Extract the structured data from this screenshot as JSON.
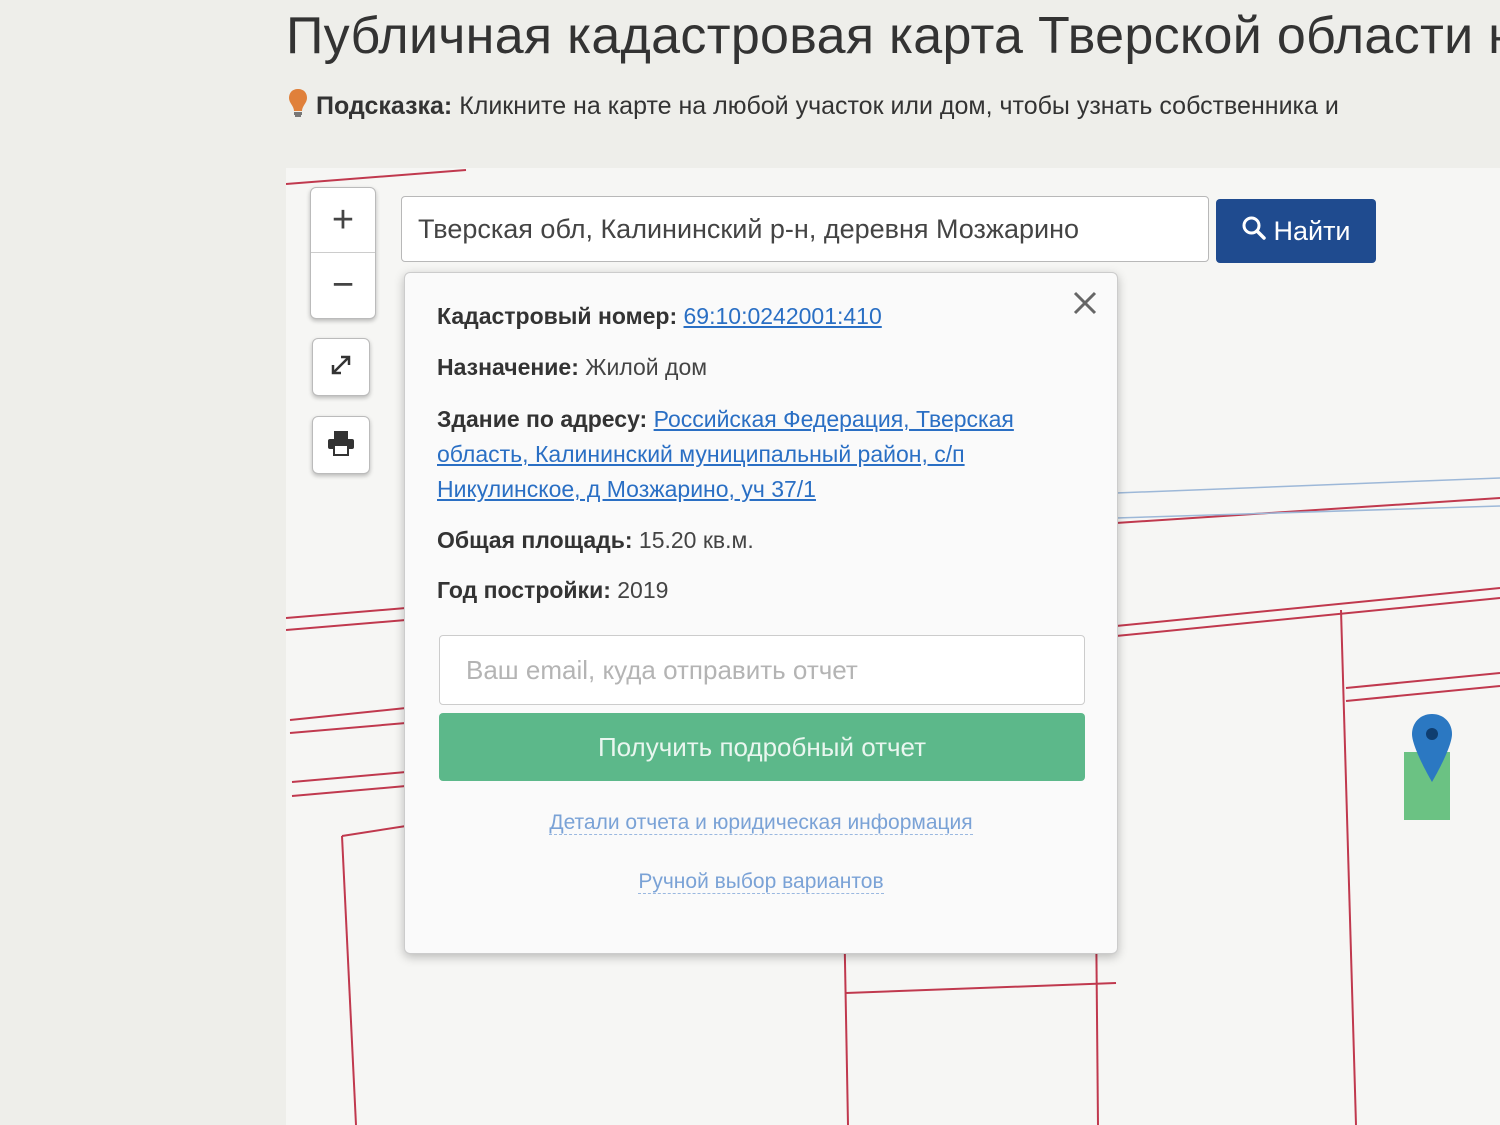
{
  "page": {
    "title": "Публичная кадастровая карта Тверской области н",
    "hint_label": "Подсказка:",
    "hint_text": " Кликните на карте на любой участок или дом, чтобы узнать собственника и"
  },
  "map_controls": {
    "zoom_in": "+",
    "zoom_out": "−",
    "fullscreen_icon": "expand-icon",
    "print_icon": "printer-icon"
  },
  "search": {
    "value": "Тверская обл, Калининский р-н, деревня Мозжарино",
    "button_label": "Найти",
    "button_color": "#1f4b8f"
  },
  "popup": {
    "cadastral_label": "Кадастровый номер:",
    "cadastral_value": "69:10:0242001:410",
    "purpose_label": "Назначение:",
    "purpose_value": "Жилой дом",
    "address_label": "Здание по адресу:",
    "address_line1": "Российская Федерация, Тверская",
    "address_line2": "область, Калининский муниципальный район, с/п",
    "address_line3": "Никулинское, д Мозжарино, уч 37/1",
    "area_label": "Общая площадь:",
    "area_value": "15.20 кв.м.",
    "year_label": "Год постройки:",
    "year_value": "2019",
    "email_placeholder": "Ваш email, куда отправить отчет",
    "report_button": "Получить подробный отчет",
    "report_button_color": "#5cb88a",
    "details_link": "Детали отчета и юридическая информация",
    "manual_link": "Ручной выбор вариантов"
  },
  "colors": {
    "parcel_border": "#c0394e",
    "marker": "#2b78c2",
    "selected_parcel": "#52b86f"
  }
}
